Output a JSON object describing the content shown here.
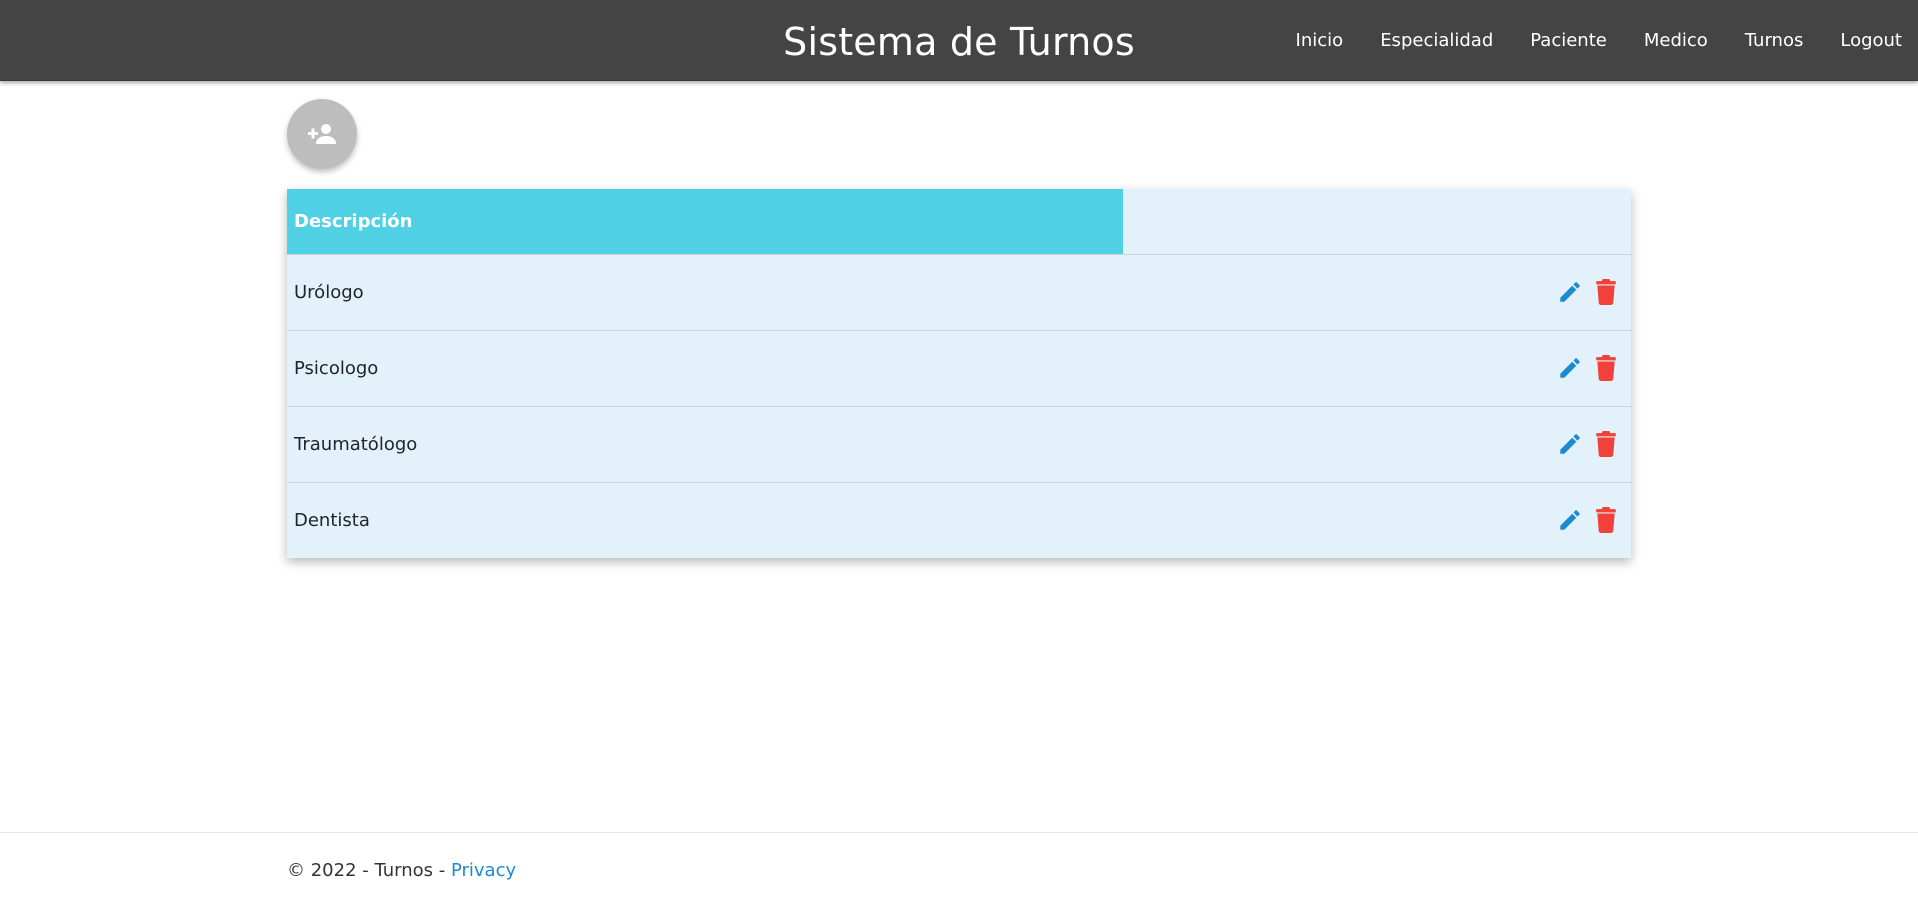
{
  "header": {
    "title": "Sistema de Turnos",
    "nav": [
      {
        "label": "Inicio"
      },
      {
        "label": "Especialidad"
      },
      {
        "label": "Paciente"
      },
      {
        "label": "Medico"
      },
      {
        "label": "Turnos"
      },
      {
        "label": "Logout"
      }
    ]
  },
  "add_button": {
    "icon": "person-add-icon"
  },
  "table": {
    "columns": [
      "Descripción",
      ""
    ],
    "rows": [
      {
        "descripcion": "Urólogo"
      },
      {
        "descripcion": "Psicologo"
      },
      {
        "descripcion": "Traumatólogo"
      },
      {
        "descripcion": "Dentista"
      }
    ],
    "row_actions": {
      "edit_icon": "pencil-icon",
      "delete_icon": "trash-icon"
    }
  },
  "footer": {
    "copyright": "© 2022 - Turnos - ",
    "privacy_label": "Privacy"
  },
  "colors": {
    "topbar": "#444444",
    "header_cell": "#4fd0e4",
    "table_bg": "#e3f1fb",
    "edit": "#1b8ad3",
    "delete": "#f0413a",
    "fab": "#bdbdbd",
    "link": "#1b8ad3"
  }
}
